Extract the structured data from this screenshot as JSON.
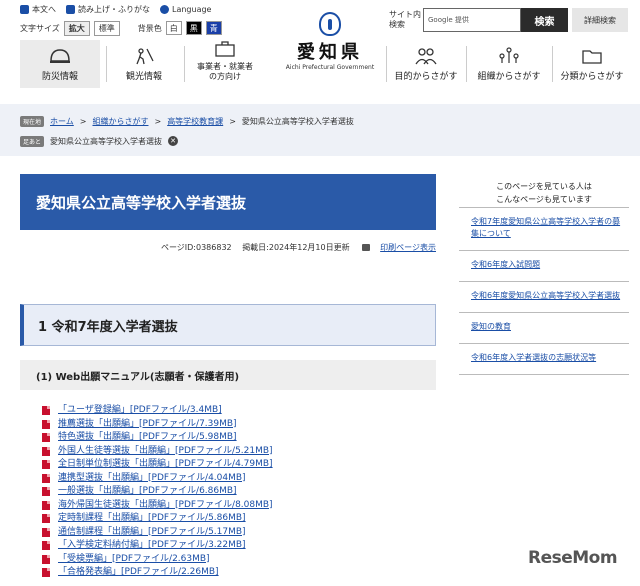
{
  "utility": {
    "text_to_speech": "本文へ",
    "furigana": "読み上げ・ふりがな",
    "language": "Language"
  },
  "font_size": {
    "label": "文字サイズ",
    "large": "拡大",
    "standard": "標準"
  },
  "bg_color": {
    "label": "背景色",
    "white": "白",
    "black": "黒",
    "blue": "青"
  },
  "logo": {
    "name": "愛知県",
    "english": "Aichi Prefectural Government"
  },
  "search": {
    "label": "サイト内検索",
    "placeholder": "Google 提供",
    "button": "検索",
    "advanced": "詳細検索"
  },
  "nav": [
    {
      "label": "防災情報"
    },
    {
      "label": "観光情報"
    },
    {
      "label": "事業者・就業者の方向け"
    },
    {
      "label": "目的からさがす"
    },
    {
      "label": "組織からさがす"
    },
    {
      "label": "分類からさがす"
    }
  ],
  "breadcrumb": {
    "current_tag": "現在地",
    "home": "ホーム",
    "org": "組織からさがす",
    "dept": "高等学校教育課",
    "page": "愛知県公立高等学校入学者選抜",
    "history_tag": "足あと",
    "history_item": "愛知県公立高等学校入学者選抜"
  },
  "page": {
    "title": "愛知県公立高等学校入学者選抜",
    "page_id": "ページID:0386832",
    "updated": "掲載日:2024年12月10日更新",
    "print": "印刷ページ表示"
  },
  "section1": {
    "title": "1 令和7年度入学者選抜",
    "sub_title": "(1) Web出願マニュアル(志願者・保護者用)"
  },
  "pdfs": [
    "「ユーザ登録編」[PDFファイル/3.4MB]",
    "推薦選抜「出願編」[PDFファイル/7.39MB]",
    "特色選抜「出願編」[PDFファイル/5.98MB]",
    "外国人生徒等選抜「出願編」[PDFファイル/5.21MB]",
    "全日制単位制選抜「出願編」[PDFファイル/4.79MB]",
    "連携型選抜「出願編」[PDFファイル/4.04MB]",
    "一般選抜「出願編」[PDFファイル/6.86MB]",
    "海外帰国生徒選抜「出願編」[PDFファイル/8.08MB]",
    "定時制課程「出願編」[PDFファイル/5.86MB]",
    "通信制課程「出願編」[PDFファイル/5.17MB]",
    "「入学検定料納付編」[PDFファイル/3.22MB]",
    "「受検票編」[PDFファイル/2.63MB]",
    "「合格発表編」[PDFファイル/2.26MB]"
  ],
  "side": {
    "heading_1": "このページを見ている人は",
    "heading_2": "こんなページも見ています",
    "links": [
      "令和7年度愛知県公立高等学校入学者の募集について",
      "令和6年度入試問題",
      "令和6年度愛知県公立高等学校入学者選抜",
      "愛知の教育",
      "令和6年度入学者選抜の志願状況等"
    ]
  },
  "watermark": "ReseMom",
  "colors": {
    "accent": "#2a5aa8",
    "link": "#1a4ea6",
    "pdf": "#c8102e"
  }
}
